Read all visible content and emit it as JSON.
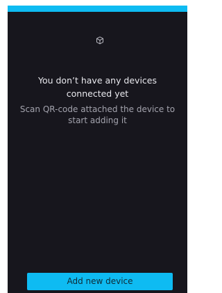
{
  "empty_state": {
    "icon": "cube-icon",
    "title": "You don’t have any devices connected yet",
    "subtitle": "Scan QR-code attached the device to start adding it"
  },
  "actions": {
    "add_device_label": "Add new device"
  },
  "colors": {
    "background": "#17161d",
    "accent": "#0ebbf2",
    "title_text": "#e9e9ee",
    "subtitle_text": "#a3a3ad"
  }
}
